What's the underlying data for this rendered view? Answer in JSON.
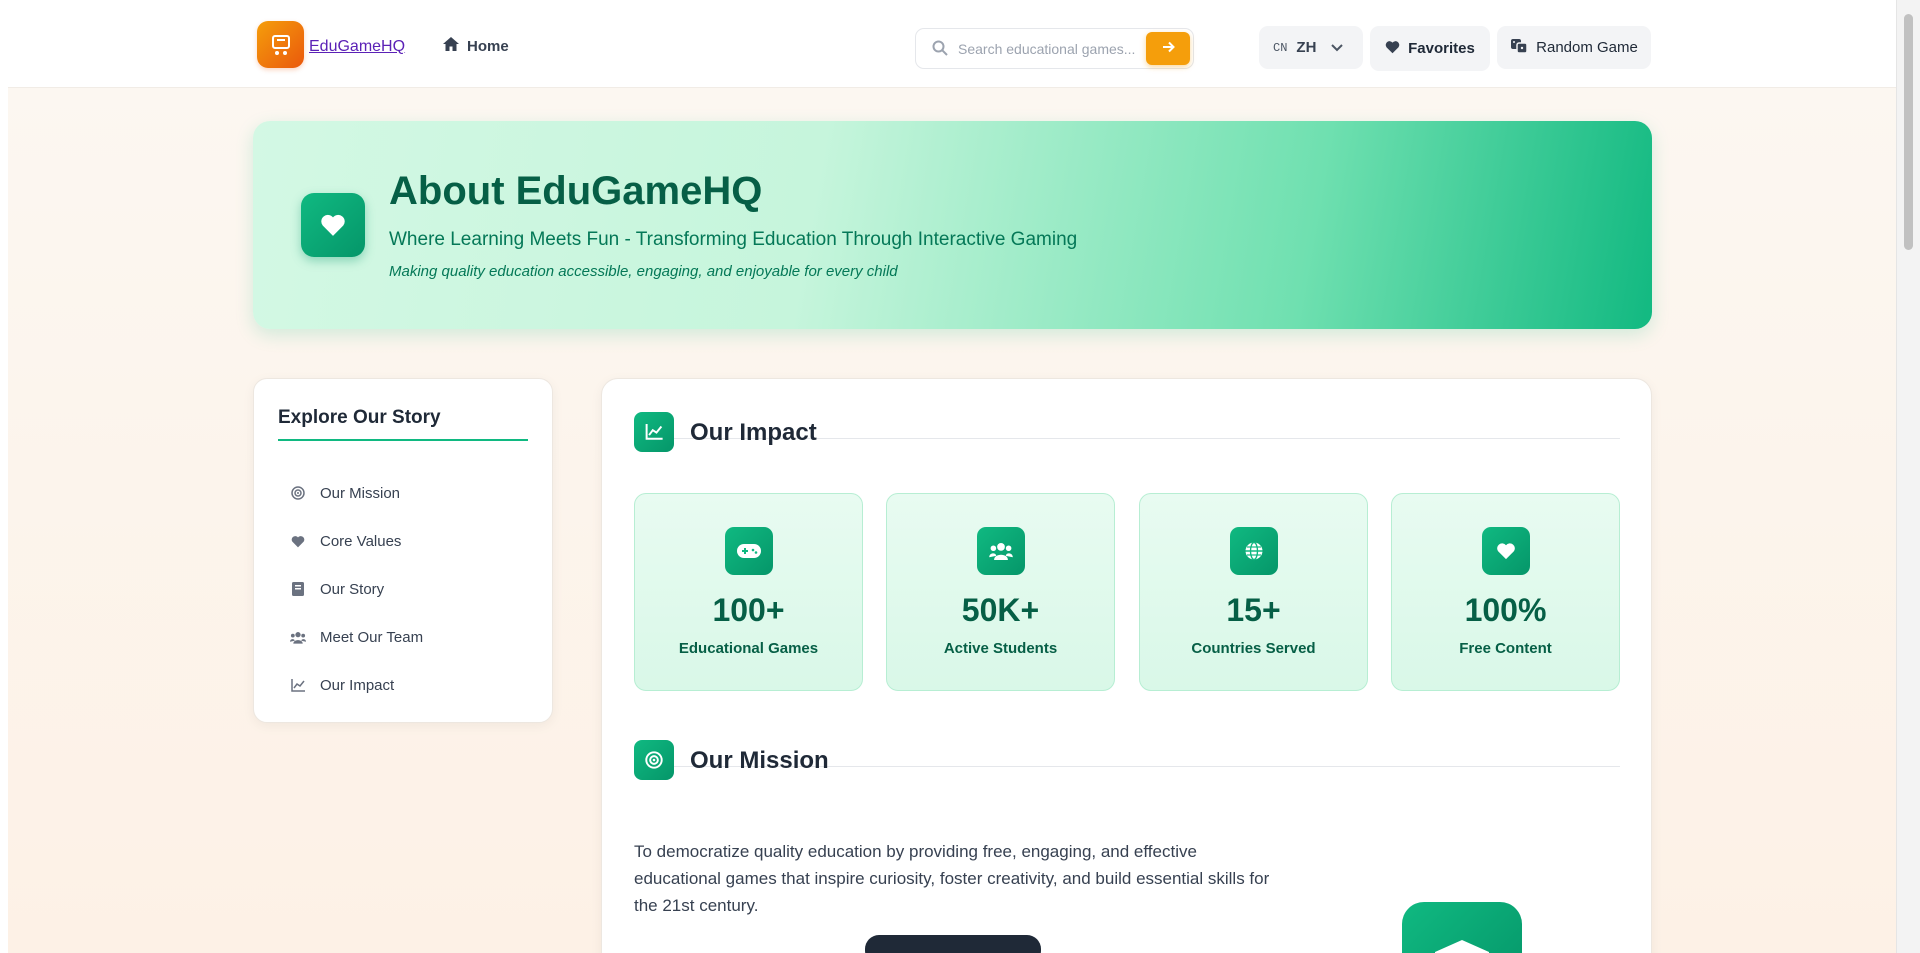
{
  "header": {
    "logo_text": "EduGameHQ",
    "home_label": "Home",
    "search_placeholder": "Search educational games...",
    "lang_code": "CN",
    "lang_label": "ZH",
    "favorites_label": "Favorites",
    "random_label": "Random Game"
  },
  "hero": {
    "title": "About EduGameHQ",
    "subtitle": "Where Learning Meets Fun - Transforming Education Through Interactive Gaming",
    "tagline": "Making quality education accessible, engaging, and enjoyable for every child"
  },
  "sidebar": {
    "title": "Explore Our Story",
    "items": [
      {
        "label": "Our Mission",
        "icon": "target-icon"
      },
      {
        "label": "Core Values",
        "icon": "heart-icon"
      },
      {
        "label": "Our Story",
        "icon": "book-icon"
      },
      {
        "label": "Meet Our Team",
        "icon": "users-icon"
      },
      {
        "label": "Our Impact",
        "icon": "chart-line-icon"
      }
    ]
  },
  "impact": {
    "title": "Our Impact",
    "stats": [
      {
        "value": "100+",
        "label": "Educational Games",
        "icon": "gamepad-icon"
      },
      {
        "value": "50K+",
        "label": "Active Students",
        "icon": "users-icon"
      },
      {
        "value": "15+",
        "label": "Countries Served",
        "icon": "globe-icon"
      },
      {
        "value": "100%",
        "label": "Free Content",
        "icon": "heart-icon"
      }
    ]
  },
  "mission": {
    "title": "Our Mission",
    "text": "To democratize quality education by providing free, engaging, and effective educational games that inspire curiosity, foster creativity, and build essential skills for the 21st century."
  },
  "colors": {
    "accent": "#10b981",
    "accent_dark": "#065f46",
    "brand_orange": "#f59e0b"
  }
}
